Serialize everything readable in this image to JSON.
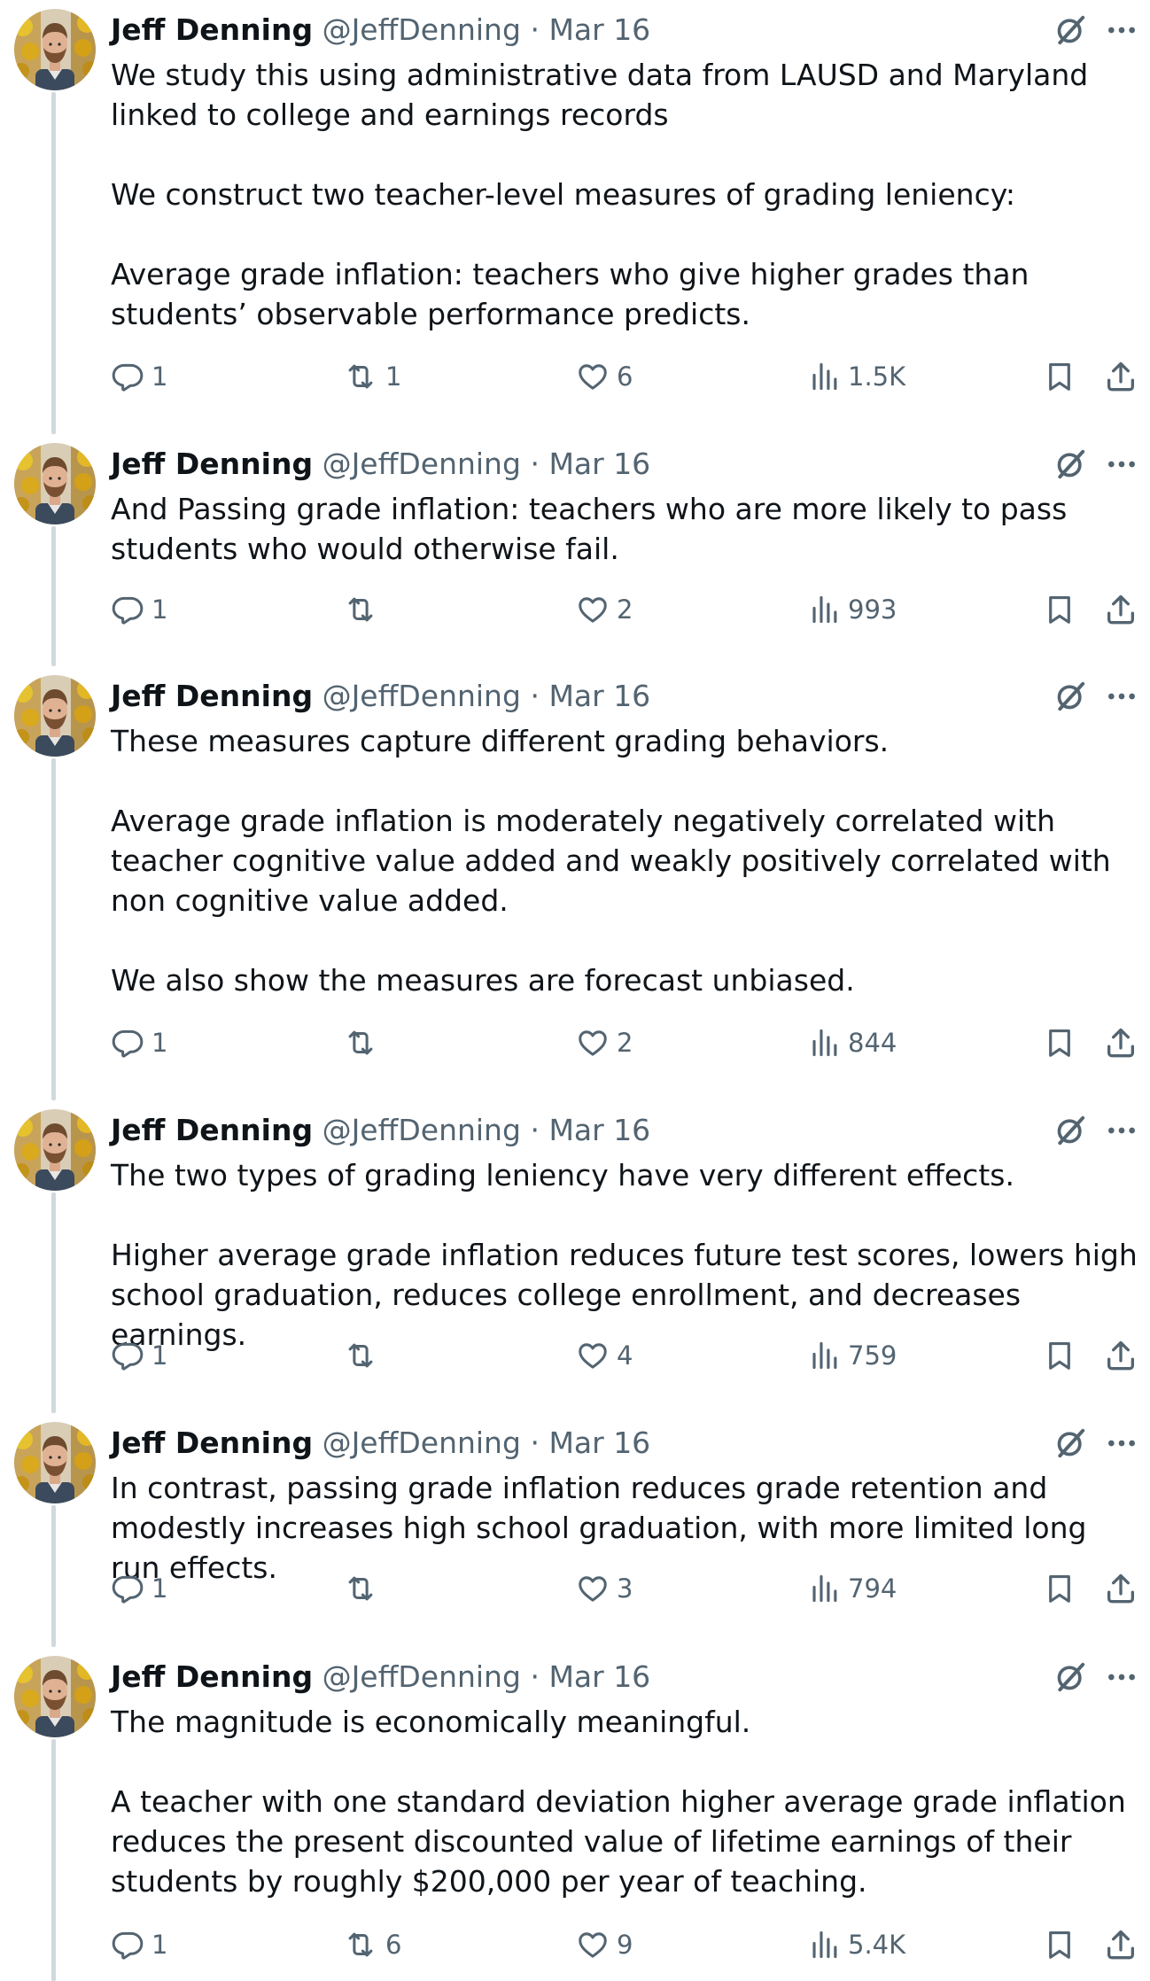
{
  "author": {
    "name": "Jeff Denning",
    "handle": "@JeffDenning",
    "separator": "·"
  },
  "tweets": [
    {
      "date": "Mar 16",
      "paragraphs": [
        "We study this using administrative data from LAUSD and Maryland linked to college and earnings records",
        "We construct two teacher-level measures of grading leniency:",
        "Average grade inflation: teachers who give higher grades than students’ observable performance predicts."
      ],
      "replies": "1",
      "retweets": "1",
      "likes": "6",
      "views": "1.5K"
    },
    {
      "date": "Mar 16",
      "paragraphs": [
        "And Passing grade inflation: teachers who are more likely to pass students who would otherwise fail."
      ],
      "replies": "1",
      "retweets": "",
      "likes": "2",
      "views": "993"
    },
    {
      "date": "Mar 16",
      "paragraphs": [
        "These measures capture different grading behaviors.",
        "Average grade inflation is moderately negatively correlated with teacher cognitive value added and weakly positively correlated with non cognitive value added.",
        "We also show the measures are forecast unbiased."
      ],
      "replies": "1",
      "retweets": "",
      "likes": "2",
      "views": "844"
    },
    {
      "date": "Mar 16",
      "paragraphs": [
        "The two types of grading leniency have very different effects.",
        "Higher average grade inflation reduces future test scores, lowers high school graduation, reduces college enrollment, and decreases earnings."
      ],
      "replies": "1",
      "retweets": "",
      "likes": "4",
      "views": "759"
    },
    {
      "date": "Mar 16",
      "paragraphs": [
        "In contrast, passing grade inflation reduces grade retention and modestly increases high school graduation, with more limited long run effects."
      ],
      "replies": "1",
      "retweets": "",
      "likes": "3",
      "views": "794"
    },
    {
      "date": "Mar 16",
      "paragraphs": [
        "The magnitude is economically meaningful.",
        "A teacher with one standard deviation higher average grade inflation reduces the present discounted value of lifetime earnings of their students by roughly $200,000 per year of teaching."
      ],
      "replies": "1",
      "retweets": "6",
      "likes": "9",
      "views": "5.4K"
    }
  ],
  "icons": {
    "reply": "reply-icon",
    "retweet": "retweet-icon",
    "like": "heart-icon",
    "views": "views-icon",
    "bookmark": "bookmark-icon",
    "share": "share-icon",
    "grok": "grok-icon",
    "more": "more-icon"
  },
  "colors": {
    "text": "#0f1419",
    "secondary": "#536471",
    "thread_line": "#cfd9de"
  }
}
